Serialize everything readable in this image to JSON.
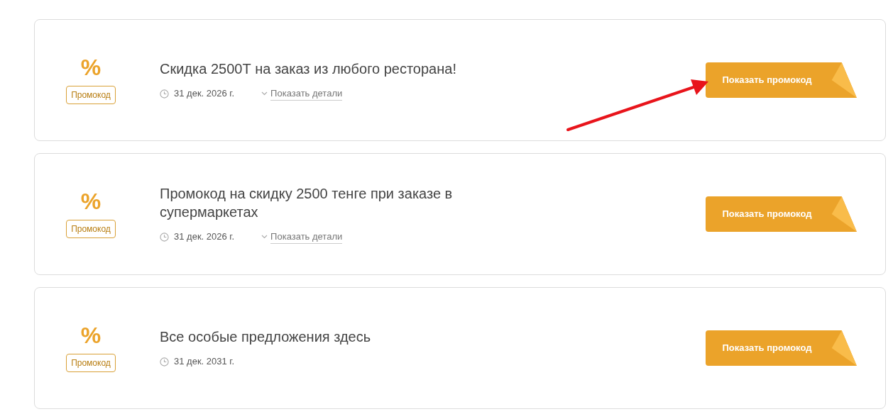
{
  "coupons": [
    {
      "symbol": "%",
      "badge": "Промокод",
      "title": "Скидка 2500Т на заказ из любого ресторана!",
      "date": "31 дек. 2026 г.",
      "details": "Показать детали",
      "button": "Показать промокод",
      "highlighted": true
    },
    {
      "symbol": "%",
      "badge": "Промокод",
      "title": "Промокод на скидку 2500 тенге при заказе в супермаркетах",
      "date": "31 дек. 2026 г.",
      "details": "Показать детали",
      "button": "Показать промокод",
      "highlighted": false
    },
    {
      "symbol": "%",
      "badge": "Промокод",
      "title": "Все особые предложения здесь",
      "date": "31 дек. 2031 г.",
      "button": "Показать промокод",
      "highlighted": false
    }
  ]
}
